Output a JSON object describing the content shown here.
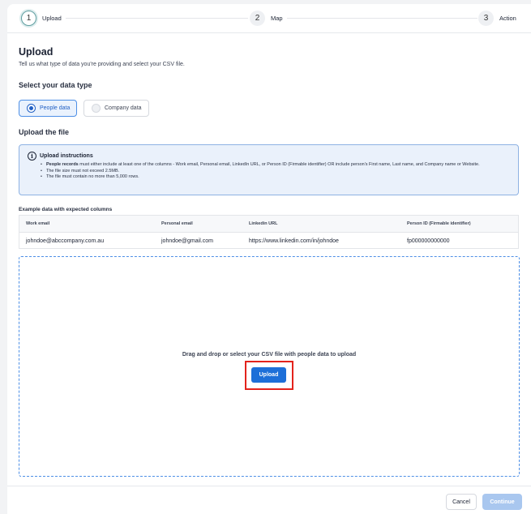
{
  "stepper": {
    "steps": [
      {
        "num": "1",
        "label": "Upload"
      },
      {
        "num": "2",
        "label": "Map"
      },
      {
        "num": "3",
        "label": "Action"
      }
    ]
  },
  "header": {
    "title": "Upload",
    "subtitle": "Tell us what type of data you're providing and select your CSV file."
  },
  "data_type": {
    "heading": "Select your data type",
    "options": [
      {
        "label": "People data",
        "selected": true
      },
      {
        "label": "Company data",
        "selected": false
      }
    ]
  },
  "upload_section": {
    "heading": "Upload the file"
  },
  "instructions": {
    "icon": "info-icon",
    "title": "Upload instructions",
    "items": [
      {
        "bold": "People records",
        "text": " must either include at least one of the columns - Work email, Personal email, LinkedIn URL, or Person ID (Firmable identifier) OR include person's First name, Last name, and Company name or Website."
      },
      {
        "bold": "",
        "text": "The file size must not exceed 2.5MB."
      },
      {
        "bold": "",
        "text": "The file must contain no more than 5,000 rows."
      }
    ]
  },
  "example": {
    "label": "Example data with expected columns",
    "columns": [
      "Work email",
      "Personal email",
      "Linkedin URL",
      "Person ID (Firmable identifier)"
    ],
    "row": [
      "johndoe@abccompany.com.au",
      "johndoe@gmail.com",
      "https://www.linkedin.com/in/johndoe",
      "fp000000000000"
    ]
  },
  "dropzone": {
    "text": "Drag and drop or select your CSV file with people data to upload",
    "button": "Upload"
  },
  "footer": {
    "cancel": "Cancel",
    "continue": "Continue"
  },
  "colors": {
    "accent": "#1d6fd8",
    "highlight": "#e3231c",
    "disabled": "#a9c7ef"
  }
}
